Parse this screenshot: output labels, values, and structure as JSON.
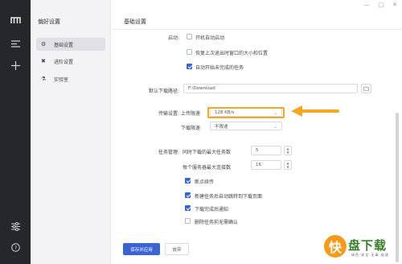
{
  "rail": {
    "icons": [
      "logo-icon",
      "menu-icon",
      "plus-icon",
      "settings-sliders-icon",
      "help-icon"
    ]
  },
  "sidebar": {
    "title": "偏好设置",
    "items": [
      {
        "label": "基础设置",
        "icon": "⚙",
        "active": true
      },
      {
        "label": "进阶设置",
        "icon": "✖",
        "active": false
      },
      {
        "label": "实验室",
        "icon": "⚗",
        "active": false
      }
    ]
  },
  "window": {
    "minimize": "—",
    "maximize": "□",
    "close": "✕"
  },
  "main": {
    "header_title": "基础设置",
    "startup": {
      "label": "启动:",
      "options": [
        {
          "text": "开机自动启动",
          "checked": false
        },
        {
          "text": "恢复上次退出时窗口的大小和位置",
          "checked": false
        },
        {
          "text": "自动开始未完成的任务",
          "checked": true
        }
      ]
    },
    "download_path": {
      "label": "默认下载路径:",
      "value": "F:\\Download"
    },
    "transfer": {
      "label": "传输设置:",
      "upload_label": "上传限速",
      "upload_value": "128 KB/s",
      "download_label": "下载限速",
      "download_value": "不限速"
    },
    "tasks": {
      "label": "任务管理:",
      "max_tasks_label": "同时下载的最大任务数",
      "max_tasks_value": "5",
      "max_conn_label": "每个服务器最大连接数",
      "max_conn_value": "16",
      "options": [
        {
          "text": "断点续传",
          "checked": true
        },
        {
          "text": "新建任务后自动跳转到下载页面",
          "checked": true
        },
        {
          "text": "下载完成后通知",
          "checked": true
        },
        {
          "text": "删除任务前无需确认",
          "checked": false
        }
      ]
    },
    "buttons": {
      "save": "保存并应用",
      "discard": "放弃"
    }
  },
  "colors": {
    "accent": "#3a63d6",
    "highlight": "#f5a623",
    "rail": "#26272b"
  },
  "watermark": {
    "logo_char": "快",
    "name": "盘下载",
    "sub": "绿色·安全·无毒·极速"
  }
}
